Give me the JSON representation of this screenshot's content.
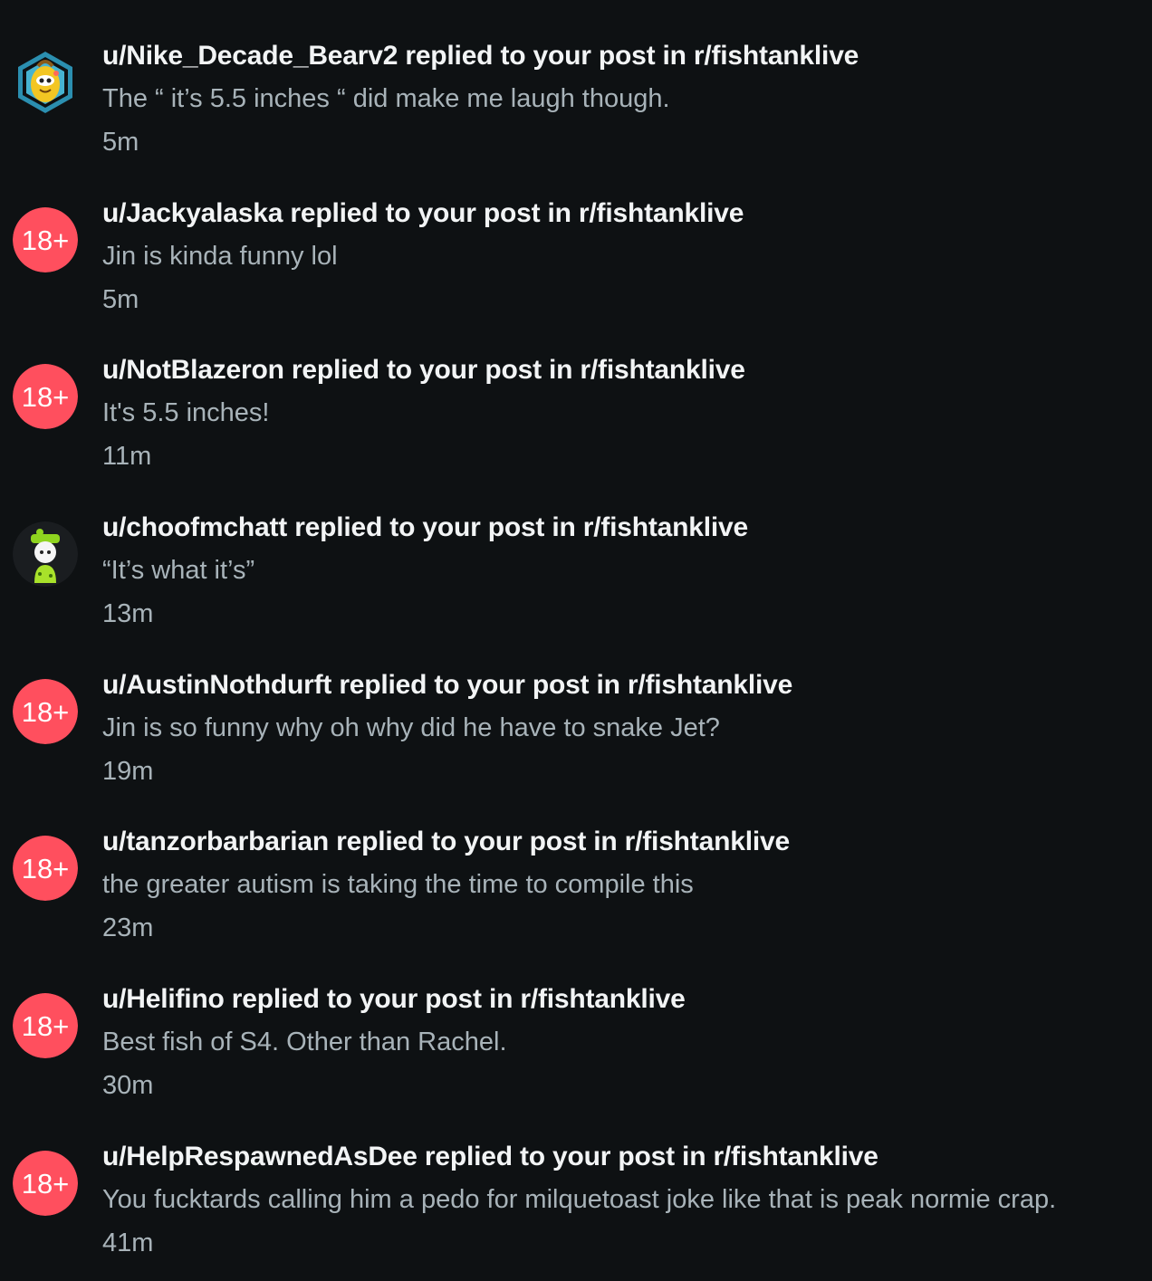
{
  "colors": {
    "background": "#0e1113",
    "title": "#f2f4f5",
    "secondary": "#a8b3b9",
    "nsfw_badge": "#ff4f5e"
  },
  "notifications": [
    {
      "title": "u/Nike_Decade_Bearv2 replied to your post in r/fishtanklive",
      "body": "The “ it’s 5.5 inches “ did make me laugh though.",
      "time": "5m",
      "avatar": "snoo-banana-avatar"
    },
    {
      "title": "u/Jackyalaska replied to your post in r/fishtanklive",
      "body": "Jin is kinda funny lol",
      "time": "5m",
      "avatar": "nsfw-badge",
      "badge": "18+"
    },
    {
      "title": "u/NotBlazeron replied to your post in r/fishtanklive",
      "body": "It's 5.5 inches!",
      "time": "11m",
      "avatar": "nsfw-badge",
      "badge": "18+"
    },
    {
      "title": "u/choofmchatt replied to your post in r/fishtanklive",
      "body": "“It’s what it’s”",
      "time": "13m",
      "avatar": "snoo-green-avatar"
    },
    {
      "title": "u/AustinNothdurft replied to your post in r/fishtanklive",
      "body": "Jin is so funny why oh why did he have to snake Jet?",
      "time": "19m",
      "avatar": "nsfw-badge",
      "badge": "18+"
    },
    {
      "title": "u/tanzorbarbarian replied to your post in r/fishtanklive",
      "body": "the greater autism is taking the time to compile this",
      "time": "23m",
      "avatar": "nsfw-badge",
      "badge": "18+"
    },
    {
      "title": "u/Helifino replied to your post in r/fishtanklive",
      "body": "Best fish of S4. Other than Rachel.",
      "time": "30m",
      "avatar": "nsfw-badge",
      "badge": "18+"
    },
    {
      "title": "u/HelpRespawnedAsDee replied to your post in r/fishtanklive",
      "body": "You fucktards calling him a pedo for milquetoast joke like that is peak normie crap.",
      "time": "41m",
      "avatar": "nsfw-badge",
      "badge": "18+"
    }
  ]
}
